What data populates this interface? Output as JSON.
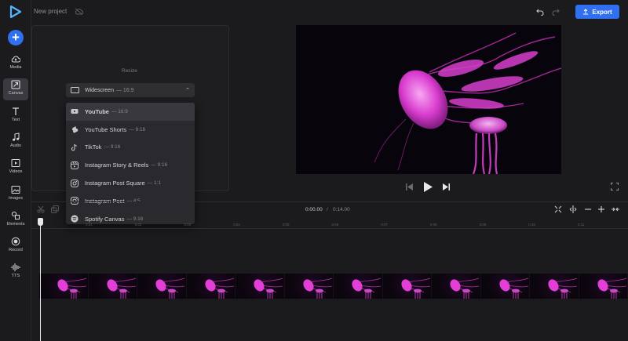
{
  "app": {
    "project_title": "New project",
    "export_label": "Export"
  },
  "colors": {
    "accent": "#2f6ff0",
    "background": "#1b1b1e",
    "jelly": "#e33fd8",
    "annotation_arrow": "#2fd6a0"
  },
  "sidebar": {
    "add_icon": "plus-icon",
    "items": [
      {
        "label": "Media",
        "icon": "cloud-upload-icon",
        "active": false
      },
      {
        "label": "Canvas",
        "icon": "resize-icon",
        "active": true
      },
      {
        "label": "Text",
        "icon": "text-icon",
        "active": false
      },
      {
        "label": "Audio",
        "icon": "music-note-icon",
        "active": false
      },
      {
        "label": "Videos",
        "icon": "video-icon",
        "active": false
      },
      {
        "label": "Images",
        "icon": "image-icon",
        "active": false
      },
      {
        "label": "Elements",
        "icon": "shapes-icon",
        "active": false
      },
      {
        "label": "Record",
        "icon": "record-icon",
        "active": false
      },
      {
        "label": "TTS",
        "icon": "waveform-icon",
        "active": false
      }
    ]
  },
  "canvas_panel": {
    "heading": "Resize",
    "selected_value": "Widescreen",
    "selected_ratio": "— 16:9",
    "options": [
      {
        "name": "YouTube",
        "ratio": "— 16:9",
        "icon": "youtube-icon",
        "selected": true
      },
      {
        "name": "YouTube Shorts",
        "ratio": "— 9:16",
        "icon": "youtube-shorts-icon",
        "selected": false
      },
      {
        "name": "TikTok",
        "ratio": "— 9:16",
        "icon": "tiktok-icon",
        "selected": false
      },
      {
        "name": "Instagram Story & Reels",
        "ratio": "— 9:16",
        "icon": "instagram-reels-icon",
        "selected": false
      },
      {
        "name": "Instagram Post Square",
        "ratio": "— 1:1",
        "icon": "instagram-icon",
        "selected": false
      },
      {
        "name": "Instagram Post",
        "ratio": "— 4:5",
        "icon": "instagram-icon",
        "selected": false
      },
      {
        "name": "Spotify Canvas",
        "ratio": "— 9:16",
        "icon": "spotify-icon",
        "selected": false
      }
    ]
  },
  "timeline": {
    "current_time": "0:00.00",
    "separator": "/",
    "total_time": "0:14.00",
    "ruler_ticks": [
      "0:01",
      "0:02",
      "0:03",
      "0:04",
      "0:05",
      "0:06",
      "0:07",
      "0:08",
      "0:09",
      "0:10",
      "0:11"
    ],
    "clip_thumbnail_count": 12
  }
}
